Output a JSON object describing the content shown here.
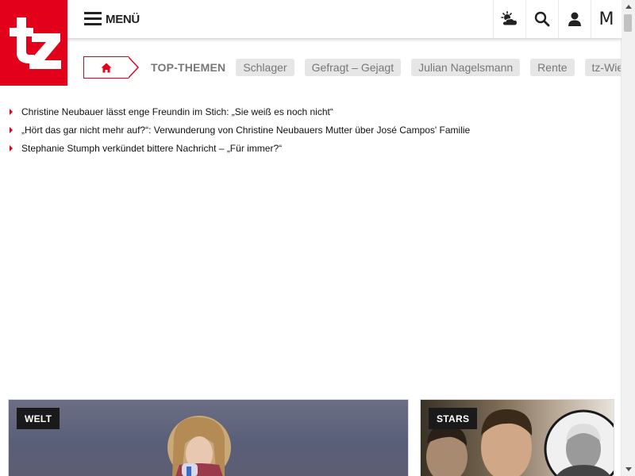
{
  "header": {
    "logo_text": "tz",
    "menu_label": "MENÜ",
    "icons": [
      "weather-icon",
      "search-icon",
      "user-icon",
      "m-icon"
    ],
    "m_letter": "M"
  },
  "topics": {
    "label": "TOP-THEMEN",
    "items": [
      "Schlager",
      "Gefragt – Gejagt",
      "Julian Nagelsmann",
      "Rente",
      "tz-Wiesn"
    ]
  },
  "headlines": [
    "Christine Neubauer lässt enge Freundin im Stich: „Sie weiß es noch nicht“",
    "„Hört das gar nicht mehr auf?“: Verwunderung von Christine Neubauers Mutter über José Campos' Familie",
    "Stephanie Stumph verkündet bittere Nachricht – „Für immer?“"
  ],
  "cards": {
    "welt_badge": "WELT",
    "stars_badge": "STARS"
  },
  "colors": {
    "brand": "#e2001a",
    "chip": "#e6e6e6",
    "text_muted": "#777777"
  }
}
